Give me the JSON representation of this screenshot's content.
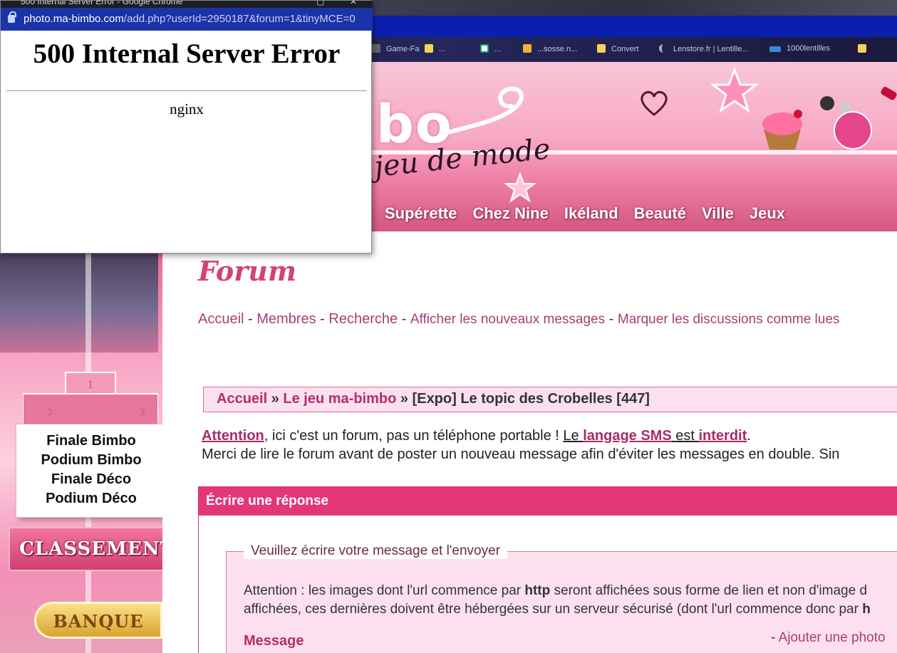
{
  "popup": {
    "window_title": "500 Internal Server Error - Google Chrome",
    "url_host": "photo.ma-bimbo.com",
    "url_path": "/add.php?userId=2950187&forum=1&tinyMCE=0",
    "heading": "500 Internal Server Error",
    "server": "nginx",
    "controls": [
      "▢",
      "✕"
    ]
  },
  "bookmarks": [
    {
      "label": "Game-Fa",
      "icon": "bookmark-icon"
    },
    {
      "label": "...",
      "icon": "folder-icon"
    },
    {
      "label": "...",
      "icon": "credit-agricole-icon"
    },
    {
      "label": "...sosse.n...",
      "icon": "mail-icon"
    },
    {
      "label": "Convert",
      "icon": "folder-icon"
    },
    {
      "label": "Lenstore.fr | Lentille...",
      "icon": "moon-icon"
    },
    {
      "label": "1000lentilles",
      "icon": "1000-icon"
    },
    {
      "label": "",
      "icon": "folder-icon"
    }
  ],
  "header": {
    "logo_text": "bo",
    "logo_subtitle": "jeu de mode",
    "nav": [
      "Supérette",
      "Chez Nine",
      "Ikéland",
      "Beauté",
      "Ville",
      "Jeux"
    ]
  },
  "sidebar": {
    "ranking": [
      "Finale Bimbo",
      "Podium Bimbo",
      "Finale Déco",
      "Podium Déco"
    ],
    "classement": "CLASSEMENT",
    "banque": "BANQUE"
  },
  "forum": {
    "title": "Forum",
    "links": [
      "Accueil",
      "Membres",
      "Recherche",
      "Afficher les nouveaux messages",
      "Marquer les discussions comme lues"
    ],
    "separator": " - ",
    "breadcrumb": {
      "home": "Accueil",
      "sep": " » ",
      "category": "Le jeu ma-bimbo",
      "topic": "[Expo] Le topic des Crobelles [447]"
    },
    "notice": {
      "attention": "Attention",
      "text1": ", ici c'est un forum, pas un téléphone portable ! ",
      "le": "Le",
      "sms": "langage SMS",
      "est": "est",
      "interdit": "interdit",
      "dot": ".",
      "line2": "Merci de lire le forum avant de poster un nouveau message afin d'éviter les messages en double. Sin"
    },
    "reply": {
      "header": "Écrire une réponse",
      "legend": "Veuillez écrire votre message et l'envoyer",
      "text_a": "Attention : les images dont l'url commence par ",
      "http": "http",
      "text_b": " seront affichées sous forme de lien et non d'image d",
      "text_c": "affichées, ces dernières doivent être hébergées sur un serveur sécurisé (dont l'url commence donc par ",
      "text_d": "h",
      "message_label": "Message",
      "photo_prefix": "- ",
      "photo_link": "Ajouter une photo"
    }
  }
}
